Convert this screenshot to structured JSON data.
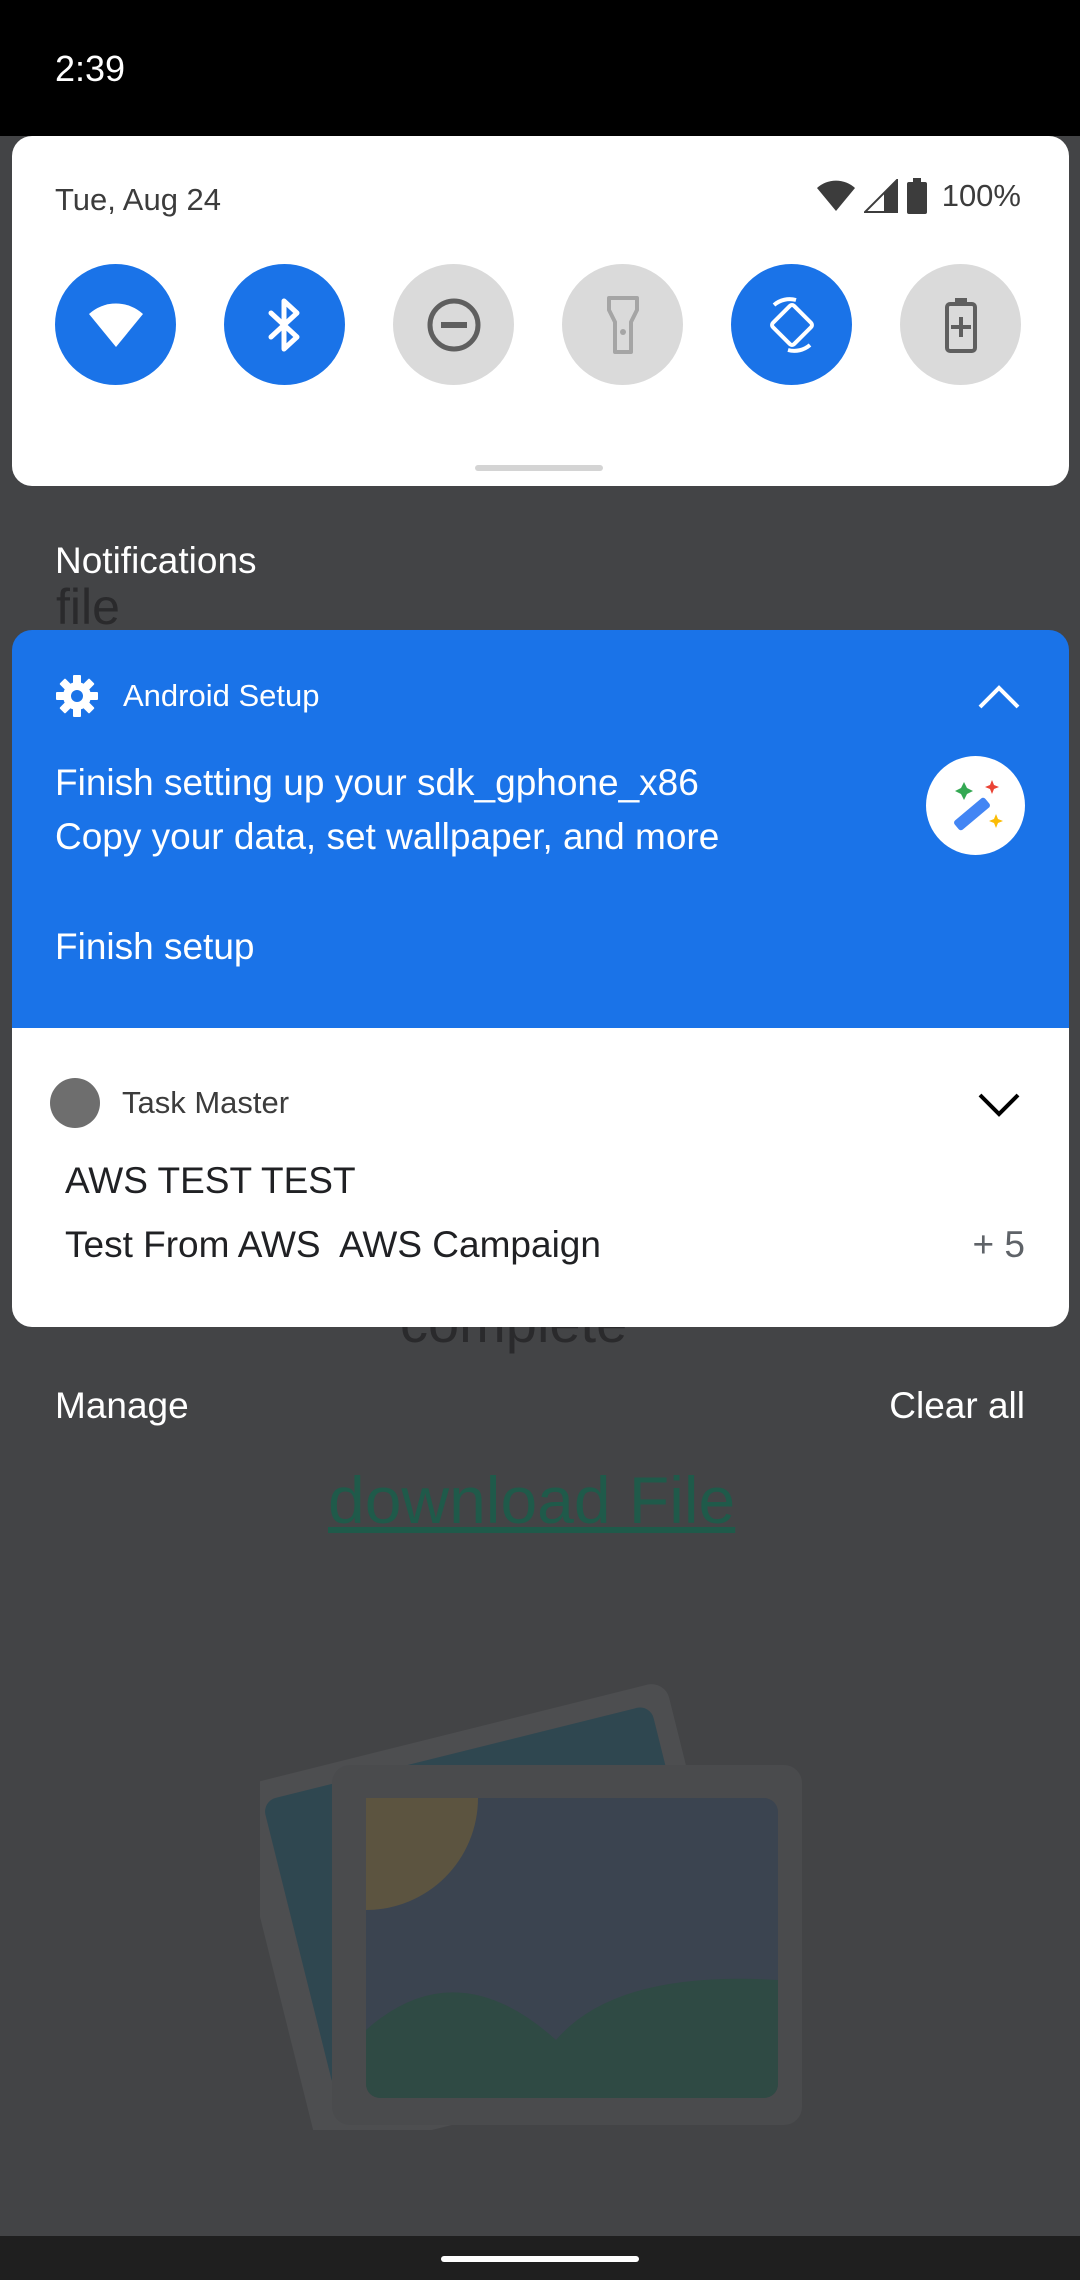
{
  "status_bar": {
    "time": "2:39"
  },
  "quick_settings": {
    "date": "Tue, Aug 24",
    "battery": "100%",
    "tiles": [
      {
        "name": "wifi",
        "state": "on"
      },
      {
        "name": "bluetooth",
        "state": "on"
      },
      {
        "name": "do-not-disturb",
        "state": "off"
      },
      {
        "name": "flashlight",
        "state": "off"
      },
      {
        "name": "auto-rotate",
        "state": "on"
      },
      {
        "name": "battery-saver",
        "state": "off"
      }
    ]
  },
  "notifications_header": "Notifications",
  "background": {
    "text_file": "file",
    "text_complete": "complete",
    "link": "download File"
  },
  "setup_notification": {
    "app_name": "Android Setup",
    "title": "Finish setting up your sdk_gphone_x86",
    "text": "Copy your data, set wallpaper, and more",
    "action": "Finish setup"
  },
  "task_notification": {
    "app_name": "Task Master",
    "title": "AWS TEST TEST",
    "text": "Test From AWS  AWS Campaign",
    "count": "+ 5"
  },
  "footer": {
    "manage": "Manage",
    "clear_all": "Clear all"
  },
  "colors": {
    "accent": "#1a73e8",
    "tile_off": "#dadada",
    "scrim": "#434446"
  }
}
